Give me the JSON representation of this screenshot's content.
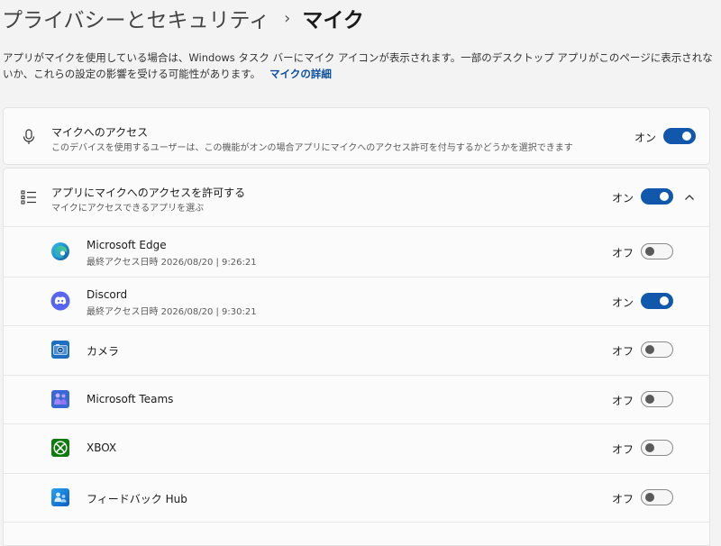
{
  "breadcrumb": {
    "parent": "プライバシーとセキュリティ",
    "separator": "›",
    "current": "マイク"
  },
  "description": {
    "text": "アプリがマイクを使用している場合は、Windows タスク バーにマイク アイコンが表示されます。一部のデスクトップ アプリがこのページに表示されないか、これらの設定の影響を受ける可能性があります。",
    "link": "マイクの詳細"
  },
  "mic_access": {
    "title": "マイクへのアクセス",
    "subtitle": "このデバイスを使用するユーザーは、この機能がオンの場合アプリにマイクへのアクセス許可を付与するかどうかを選択できます",
    "state_label": "オン",
    "on": true,
    "icon": "microphone-icon"
  },
  "app_access": {
    "title": "アプリにマイクへのアクセスを許可する",
    "subtitle": "マイクにアクセスできるアプリを選ぶ",
    "state_label": "オン",
    "on": true,
    "icon": "list-icon",
    "expanded": true
  },
  "apps": [
    {
      "name": "Microsoft Edge",
      "last_access": "最終アクセス日時 2026/08/20 | 9:26:21",
      "state_label": "オフ",
      "on": false,
      "icon": "edge-icon"
    },
    {
      "name": "Discord",
      "last_access": "最終アクセス日時 2026/08/20 | 9:30:21",
      "state_label": "オン",
      "on": true,
      "icon": "discord-icon"
    },
    {
      "name": "カメラ",
      "last_access": "",
      "state_label": "オフ",
      "on": false,
      "icon": "camera-icon"
    },
    {
      "name": "Microsoft Teams",
      "last_access": "",
      "state_label": "オフ",
      "on": false,
      "icon": "teams-icon"
    },
    {
      "name": "XBOX",
      "last_access": "",
      "state_label": "オフ",
      "on": false,
      "icon": "xbox-icon"
    },
    {
      "name": "フィードバック Hub",
      "last_access": "",
      "state_label": "オフ",
      "on": false,
      "icon": "feedback-hub-icon"
    }
  ],
  "colors": {
    "accent": "#1158ad",
    "link": "#0a4f9e",
    "page_background": "#f3f3f3",
    "card_background": "#fbfbfb"
  }
}
